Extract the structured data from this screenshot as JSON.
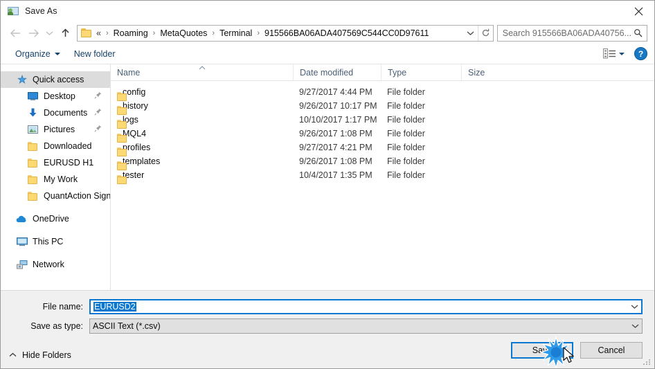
{
  "window": {
    "title": "Save As",
    "app_icon": "save-as-folder-person-icon",
    "close_label": "✕"
  },
  "address_bar": {
    "back_icon": "arrow-left-icon",
    "forward_icon": "arrow-right-icon",
    "recent_icon": "chevron-down-icon",
    "up_icon": "arrow-up-icon",
    "folder_icon": "folder-icon",
    "lead": "«",
    "crumbs": [
      "Roaming",
      "MetaQuotes",
      "Terminal",
      "915566BA06ADA407569C544CC0D97611"
    ],
    "separator": "›",
    "dropdown_icon": "chevron-down-icon",
    "refresh_icon": "refresh-icon"
  },
  "search": {
    "placeholder": "Search 915566BA06ADA40756...",
    "icon": "search-icon"
  },
  "toolbar": {
    "organize_label": "Organize",
    "new_folder_label": "New folder",
    "view_icon": "view-layout-icon",
    "view_caret_icon": "chevron-down-icon",
    "help_label": "?",
    "help_icon": "help-circle-icon"
  },
  "sidebar": {
    "items": [
      {
        "label": "Quick access",
        "icon": "star-pin-icon",
        "selected": true,
        "child": false,
        "pinned": false
      },
      {
        "label": "Desktop",
        "icon": "desktop-icon",
        "selected": false,
        "child": true,
        "pinned": true
      },
      {
        "label": "Documents",
        "icon": "documents-download-icon",
        "selected": false,
        "child": true,
        "pinned": true
      },
      {
        "label": "Pictures",
        "icon": "pictures-icon",
        "selected": false,
        "child": true,
        "pinned": true
      },
      {
        "label": "Downloaded",
        "icon": "folder-icon",
        "selected": false,
        "child": true,
        "pinned": false
      },
      {
        "label": "EURUSD H1",
        "icon": "folder-icon",
        "selected": false,
        "child": true,
        "pinned": false
      },
      {
        "label": "My Work",
        "icon": "folder-icon",
        "selected": false,
        "child": true,
        "pinned": false
      },
      {
        "label": "QuantAction Signal",
        "icon": "folder-icon",
        "selected": false,
        "child": true,
        "pinned": false
      }
    ],
    "groups": [
      {
        "label": "OneDrive",
        "icon": "onedrive-cloud-icon"
      },
      {
        "label": "This PC",
        "icon": "this-pc-icon"
      },
      {
        "label": "Network",
        "icon": "network-icon"
      }
    ],
    "pin_glyph": "✒"
  },
  "file_list": {
    "columns": [
      "Name",
      "Date modified",
      "Type",
      "Size"
    ],
    "sort_column": "Name",
    "sort_caret": "▲",
    "rows": [
      {
        "name": "config",
        "date": "9/27/2017 4:44 PM",
        "type": "File folder",
        "size": "",
        "icon": "folder-icon"
      },
      {
        "name": "history",
        "date": "9/26/2017 10:17 PM",
        "type": "File folder",
        "size": "",
        "icon": "folder-icon"
      },
      {
        "name": "logs",
        "date": "10/10/2017 1:17 PM",
        "type": "File folder",
        "size": "",
        "icon": "folder-icon"
      },
      {
        "name": "MQL4",
        "date": "9/26/2017 1:08 PM",
        "type": "File folder",
        "size": "",
        "icon": "folder-icon"
      },
      {
        "name": "profiles",
        "date": "9/27/2017 4:21 PM",
        "type": "File folder",
        "size": "",
        "icon": "folder-icon"
      },
      {
        "name": "templates",
        "date": "9/26/2017 1:08 PM",
        "type": "File folder",
        "size": "",
        "icon": "folder-icon"
      },
      {
        "name": "tester",
        "date": "10/4/2017 1:35 PM",
        "type": "File folder",
        "size": "",
        "icon": "folder-icon"
      }
    ]
  },
  "form": {
    "file_name_label": "File name:",
    "file_name_value": "EURUSD2",
    "save_type_label": "Save as type:",
    "save_type_value": "ASCII Text (*.csv)",
    "dropdown_icon": "chevron-down-icon"
  },
  "actions": {
    "save_label": "Save",
    "cancel_label": "Cancel",
    "hide_folders_label": "Hide Folders",
    "hide_folders_icon": "chevron-up-icon",
    "resize_grip_icon": "resize-grip-icon",
    "click_burst_icon": "click-burst-icon",
    "cursor_icon": "mouse-cursor-icon"
  },
  "colors": {
    "accent": "#0a78d1",
    "folder": "#fcd975",
    "toolbar_text": "#16416b",
    "footer_bg": "#f0f0f0",
    "selection": "#dcdcdc"
  }
}
